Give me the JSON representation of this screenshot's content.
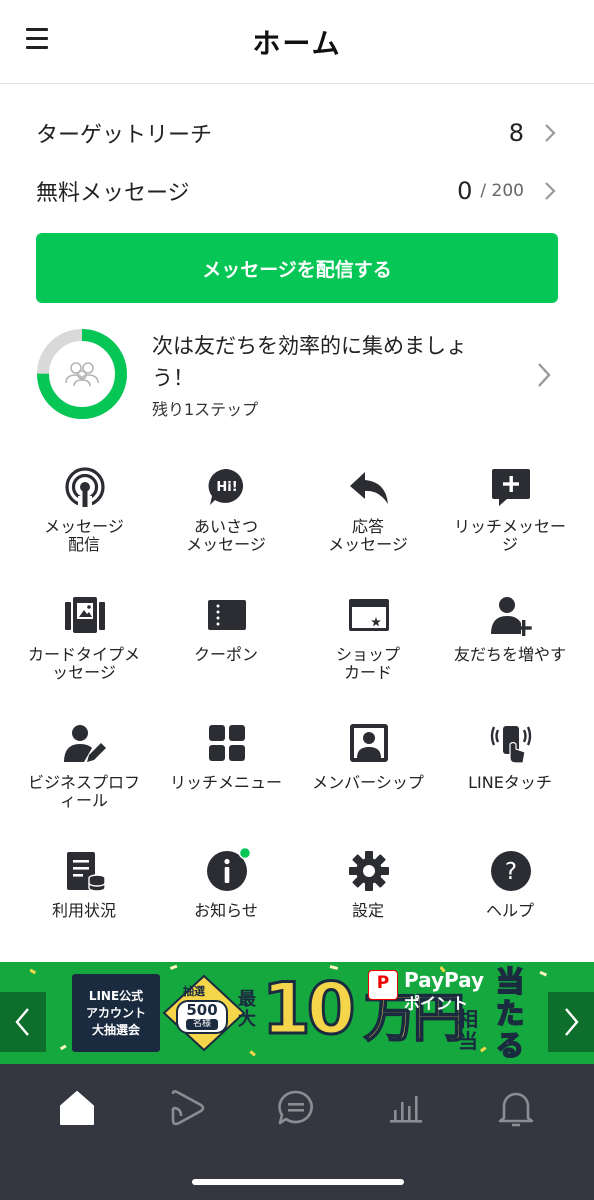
{
  "header": {
    "title": "ホーム",
    "menu_icon": "hamburger-menu-icon"
  },
  "stats": {
    "target_reach": {
      "label": "ターゲットリーチ",
      "value": "8"
    },
    "free_messages": {
      "label": "無料メッセージ",
      "value": "0",
      "limit": "/ 200"
    }
  },
  "primary_action": {
    "label": "メッセージを配信する",
    "color": "#06c755"
  },
  "progress": {
    "title": "次は友だちを効率的に集めましょう！",
    "subtitle": "残り1ステップ",
    "completed_fraction": 0.75,
    "ring_color": "#06c755",
    "ring_track_color": "#d9d9d9"
  },
  "grid": [
    {
      "label": "メッセージ\n配信",
      "icon": "broadcast-icon"
    },
    {
      "label": "あいさつ\nメッセージ",
      "icon": "greeting-hi-icon"
    },
    {
      "label": "応答\nメッセージ",
      "icon": "reply-arrow-icon"
    },
    {
      "label": "リッチメッセー\nジ",
      "icon": "rich-message-plus-icon"
    },
    {
      "label": "カードタイプメ\nッセージ",
      "icon": "card-type-icon"
    },
    {
      "label": "クーポン",
      "icon": "coupon-icon"
    },
    {
      "label": "ショップ\nカード",
      "icon": "shop-card-icon"
    },
    {
      "label": "友だちを増やす",
      "icon": "add-friend-icon"
    },
    {
      "label": "ビジネスプロフ\nィール",
      "icon": "business-profile-icon"
    },
    {
      "label": "リッチメニュー",
      "icon": "rich-menu-grid-icon"
    },
    {
      "label": "メンバーシップ",
      "icon": "membership-icon"
    },
    {
      "label": "LINEタッチ",
      "icon": "line-touch-icon"
    },
    {
      "label": "利用状況",
      "icon": "usage-icon"
    },
    {
      "label": "お知らせ",
      "icon": "info-notice-icon",
      "has_badge": true
    },
    {
      "label": "設定",
      "icon": "settings-gear-icon"
    },
    {
      "label": "ヘルプ",
      "icon": "help-question-icon"
    }
  ],
  "banner": {
    "campaign": "LINE公式\nアカウント\n大抽選会",
    "lottery": "抽選",
    "count": "500",
    "count_unit": "名様",
    "max": "最大",
    "amount": "10",
    "yen": "万円",
    "paypay": "PayPay",
    "points": "ポイント",
    "equiv": "相当",
    "hit": "当たる"
  },
  "bottom_nav": [
    {
      "icon": "home-icon",
      "active": true
    },
    {
      "icon": "voom-play-icon",
      "active": false
    },
    {
      "icon": "chat-bubble-icon",
      "active": false
    },
    {
      "icon": "analytics-chart-icon",
      "active": false
    },
    {
      "icon": "notification-bell-icon",
      "active": false
    }
  ]
}
